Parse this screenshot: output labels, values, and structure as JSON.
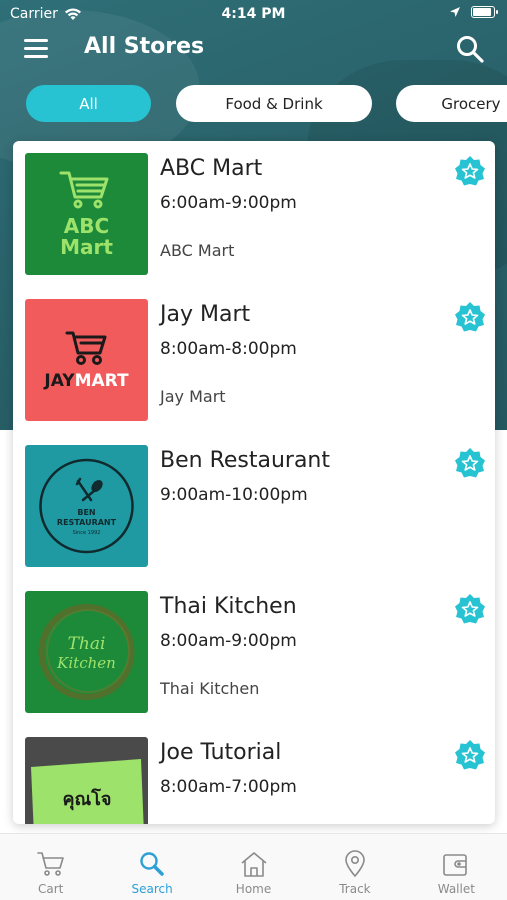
{
  "status_bar": {
    "carrier": "Carrier",
    "time": "4:14 PM"
  },
  "header": {
    "title": "All Stores"
  },
  "filters": [
    {
      "label": "All",
      "active": true
    },
    {
      "label": "Food & Drink",
      "active": false
    },
    {
      "label": "Grocery",
      "active": false
    }
  ],
  "stores": [
    {
      "name": "ABC Mart",
      "hours": "6:00am-9:00pm",
      "description": "ABC Mart",
      "logo_text_1": "ABC",
      "logo_text_2": "Mart"
    },
    {
      "name": "Jay Mart",
      "hours": "8:00am-8:00pm",
      "description": "Jay Mart",
      "logo_text_1": "JAY",
      "logo_text_2": "MART"
    },
    {
      "name": "Ben Restaurant",
      "hours": "9:00am-10:00pm",
      "description": "",
      "logo_text_1": "BEN",
      "logo_text_2": "RESTAURANT",
      "logo_text_3": "Since 1992"
    },
    {
      "name": "Thai Kitchen",
      "hours": "8:00am-9:00pm",
      "description": "Thai Kitchen",
      "logo_text_1": "Thai",
      "logo_text_2": "Kitchen"
    },
    {
      "name": "Joe Tutorial",
      "hours": "8:00am-7:00pm",
      "description": "",
      "logo_text_1": "คุณโจ"
    }
  ],
  "tabs": [
    {
      "label": "Cart",
      "icon": "cart-icon",
      "active": false
    },
    {
      "label": "Search",
      "icon": "search-icon",
      "active": true
    },
    {
      "label": "Home",
      "icon": "home-icon",
      "active": false
    },
    {
      "label": "Track",
      "icon": "location-pin-icon",
      "active": false
    },
    {
      "label": "Wallet",
      "icon": "wallet-icon",
      "active": false
    }
  ],
  "colors": {
    "accent": "#27c3d2",
    "header_bg": "#2a636b",
    "active_tab": "#2c9fd6",
    "abc_logo_bg": "#1d8a3a",
    "abc_logo_fg": "#9de26a",
    "jay_logo_bg": "#f25b5b",
    "ben_logo_bg": "#1f9aa3",
    "thai_logo_bg": "#1d8a3a",
    "joe_logo_bg": "#4a4a4a",
    "joe_logo_fg": "#9de26a"
  }
}
